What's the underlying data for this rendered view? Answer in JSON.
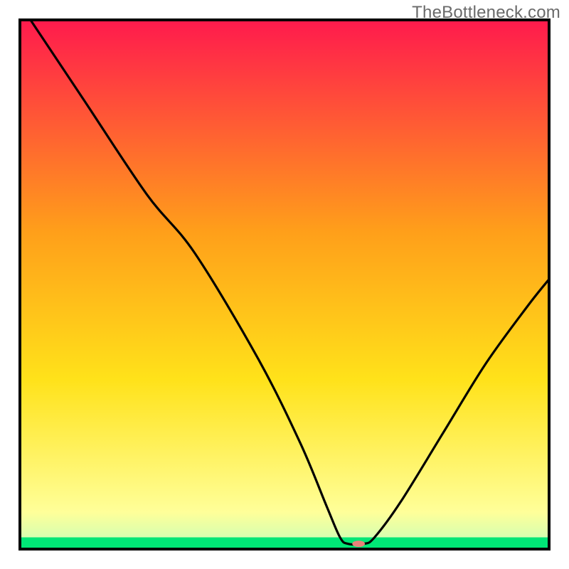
{
  "watermark": "TheBottleneck.com",
  "chart_data": {
    "type": "line",
    "title": "",
    "xlabel": "",
    "ylabel": "",
    "xlim": [
      0,
      100
    ],
    "ylim": [
      0,
      100
    ],
    "background_gradient": {
      "top": "#ff1a4d",
      "mid_upper": "#ff9f1a",
      "mid": "#ffe21a",
      "mid_lower": "#ffff99",
      "bottom_band": "#00e676",
      "bottom_band_fraction": 0.022
    },
    "marker": {
      "x": 64,
      "y": 1,
      "color": "#e9827a",
      "rx": 1.2,
      "ry": 0.6
    },
    "series": [
      {
        "name": "curve",
        "stroke": "#000000",
        "points": [
          {
            "x": 2,
            "y": 100
          },
          {
            "x": 12,
            "y": 85
          },
          {
            "x": 24,
            "y": 67
          },
          {
            "x": 33,
            "y": 56
          },
          {
            "x": 45,
            "y": 36
          },
          {
            "x": 53,
            "y": 20
          },
          {
            "x": 58,
            "y": 8
          },
          {
            "x": 60.5,
            "y": 2.2
          },
          {
            "x": 62,
            "y": 1
          },
          {
            "x": 65,
            "y": 1
          },
          {
            "x": 67,
            "y": 2.2
          },
          {
            "x": 72,
            "y": 9
          },
          {
            "x": 80,
            "y": 22
          },
          {
            "x": 88,
            "y": 35
          },
          {
            "x": 96,
            "y": 46
          },
          {
            "x": 100,
            "y": 51
          }
        ]
      }
    ]
  }
}
